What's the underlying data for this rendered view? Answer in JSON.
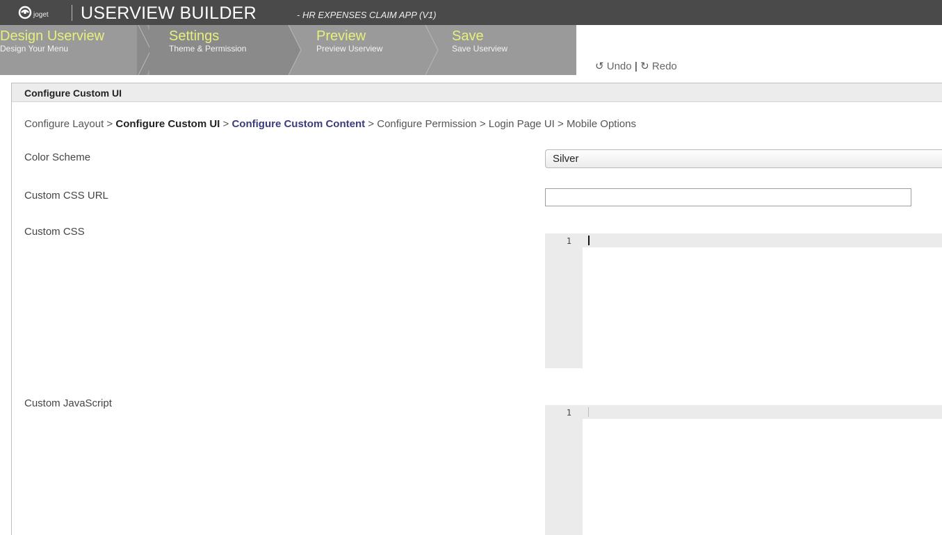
{
  "header": {
    "logo_text": "joget",
    "title": "USERVIEW BUILDER",
    "subtitle": "- HR EXPENSES CLAIM APP (V1)"
  },
  "steps": [
    {
      "label": "Design Userview",
      "sub": "Design Your Menu"
    },
    {
      "label": "Settings",
      "sub": "Theme & Permission"
    },
    {
      "label": "Preview",
      "sub": "Preview Userview"
    },
    {
      "label": "Save",
      "sub": "Save Userview"
    }
  ],
  "toolbar": {
    "undo_label": "Undo",
    "separator": "|",
    "redo_label": "Redo"
  },
  "panel": {
    "title": "Configure Custom UI"
  },
  "breadcrumb": {
    "items": [
      {
        "label": "Configure Layout"
      },
      {
        "label": "Configure Custom UI"
      },
      {
        "label": "Configure Custom Content"
      },
      {
        "label": "Configure Permission"
      },
      {
        "label": "Login Page UI"
      },
      {
        "label": "Mobile Options"
      }
    ],
    "separator": ">"
  },
  "form": {
    "color_scheme": {
      "label": "Color Scheme",
      "value": "Silver"
    },
    "custom_css_url": {
      "label": "Custom CSS URL",
      "value": ""
    },
    "custom_css": {
      "label": "Custom CSS",
      "line_number": "1"
    },
    "custom_js": {
      "label": "Custom JavaScript",
      "line_number": "1"
    }
  },
  "colors": {
    "header_bg": "#4a4a4a",
    "steps_bg": "#9a9a9a",
    "step_label": "#e8f07a",
    "breadcrumb_next": "#3b3d7a"
  }
}
